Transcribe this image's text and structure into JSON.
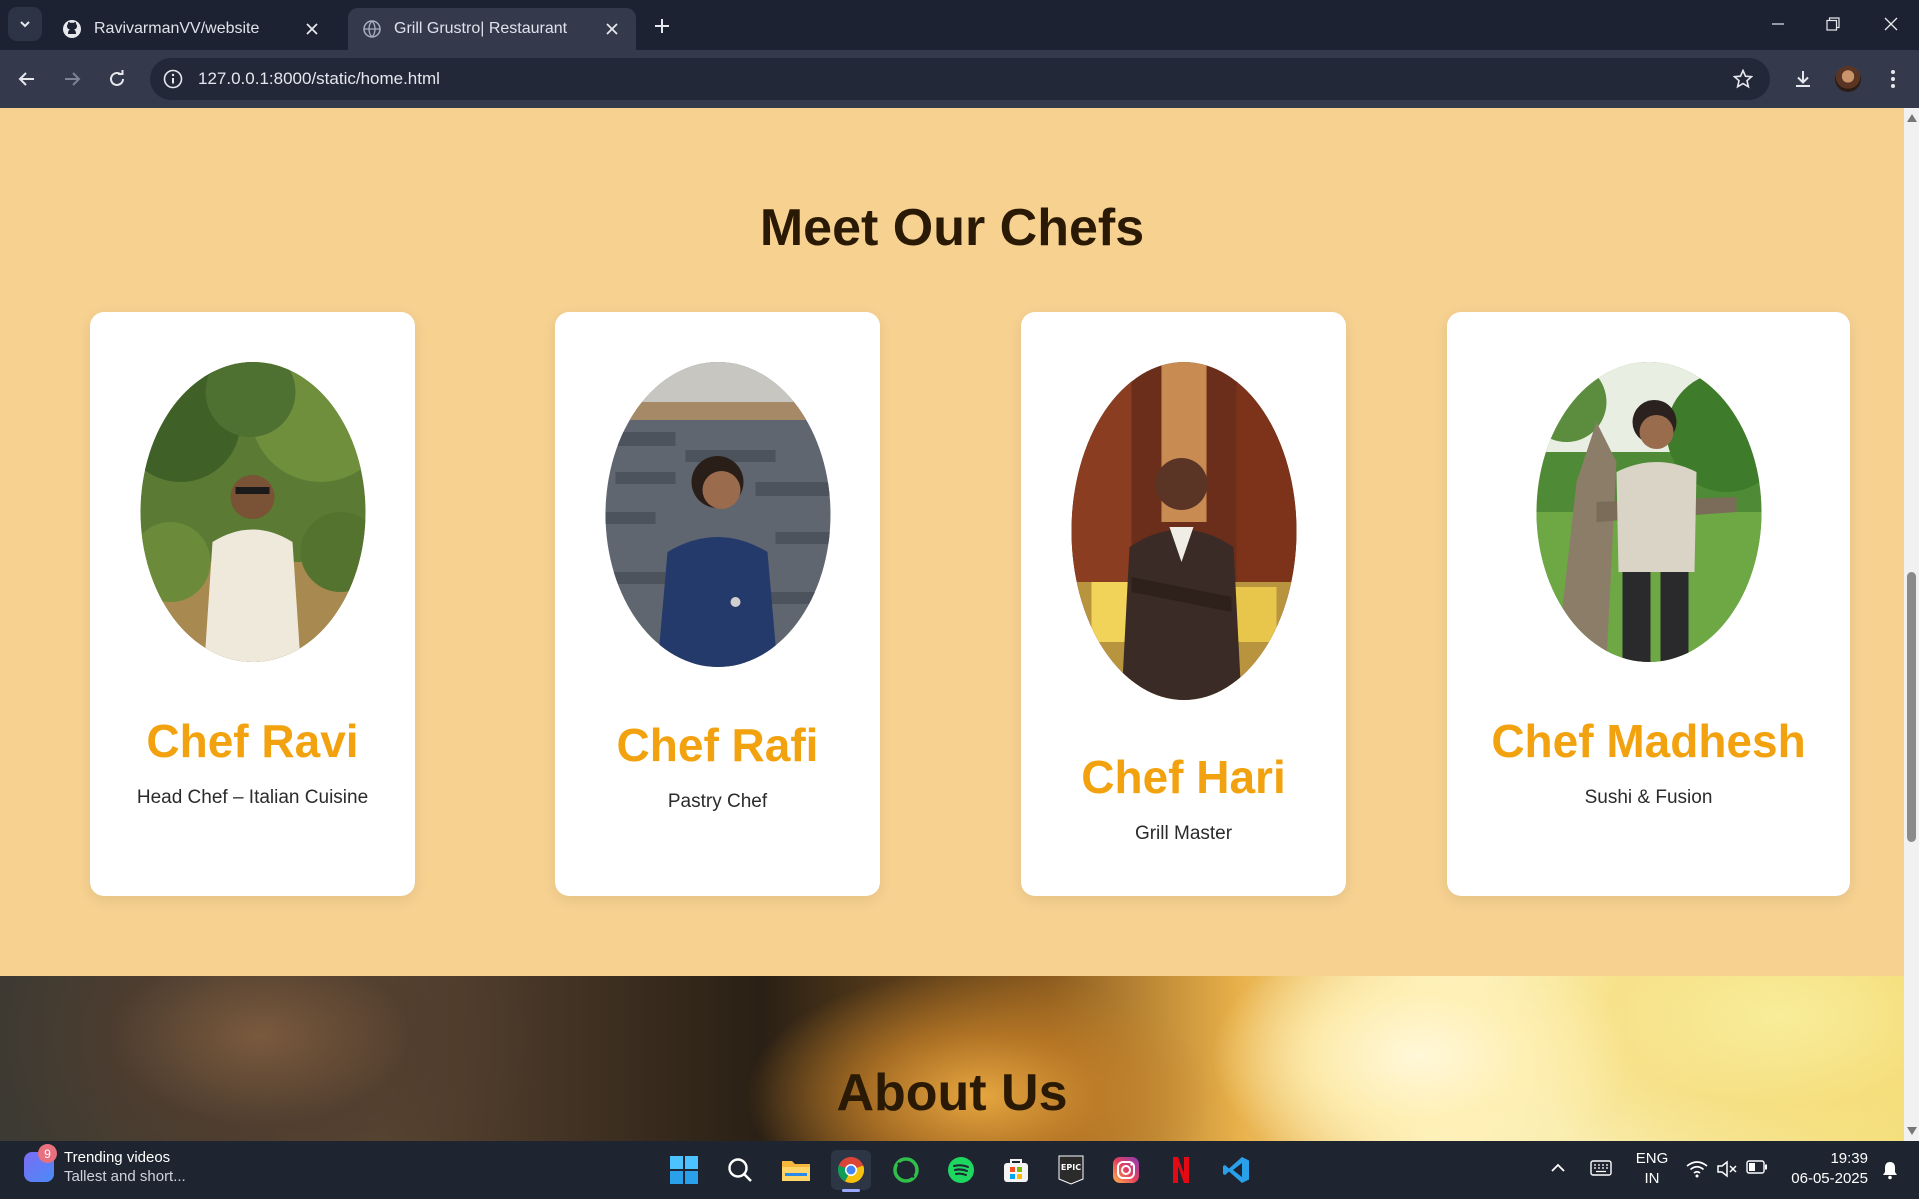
{
  "browser": {
    "tabs": [
      {
        "title": "RavivarmanVV/website",
        "favicon": "github-icon"
      },
      {
        "title": "Grill Grustro| Restaurant",
        "favicon": "globe-icon"
      }
    ],
    "url": "127.0.0.1:8000/static/home.html"
  },
  "page": {
    "chefs_heading": "Meet Our Chefs",
    "chefs": [
      {
        "name": "Chef Ravi",
        "role": "Head Chef – Italian Cuisine"
      },
      {
        "name": "Chef Rafi",
        "role": "Pastry Chef"
      },
      {
        "name": "Chef Hari",
        "role": "Grill Master"
      },
      {
        "name": "Chef Madhesh",
        "role": "Sushi & Fusion"
      }
    ],
    "about_heading": "About Us",
    "colors": {
      "background": "#f6d190",
      "accent": "#f2a20e",
      "heading": "#2a1a05"
    }
  },
  "taskbar": {
    "widget": {
      "badge": "9",
      "title": "Trending videos",
      "subtitle": "Tallest and short..."
    },
    "apps": [
      "windows-start-icon",
      "search-icon",
      "file-explorer-icon",
      "chrome-icon",
      "xbox-icon",
      "spotify-icon",
      "store-icon",
      "epic-games-icon",
      "instagram-icon",
      "netflix-icon",
      "vscode-icon"
    ],
    "lang_line1": "ENG",
    "lang_line2": "IN",
    "time": "19:39",
    "date": "06-05-2025"
  }
}
